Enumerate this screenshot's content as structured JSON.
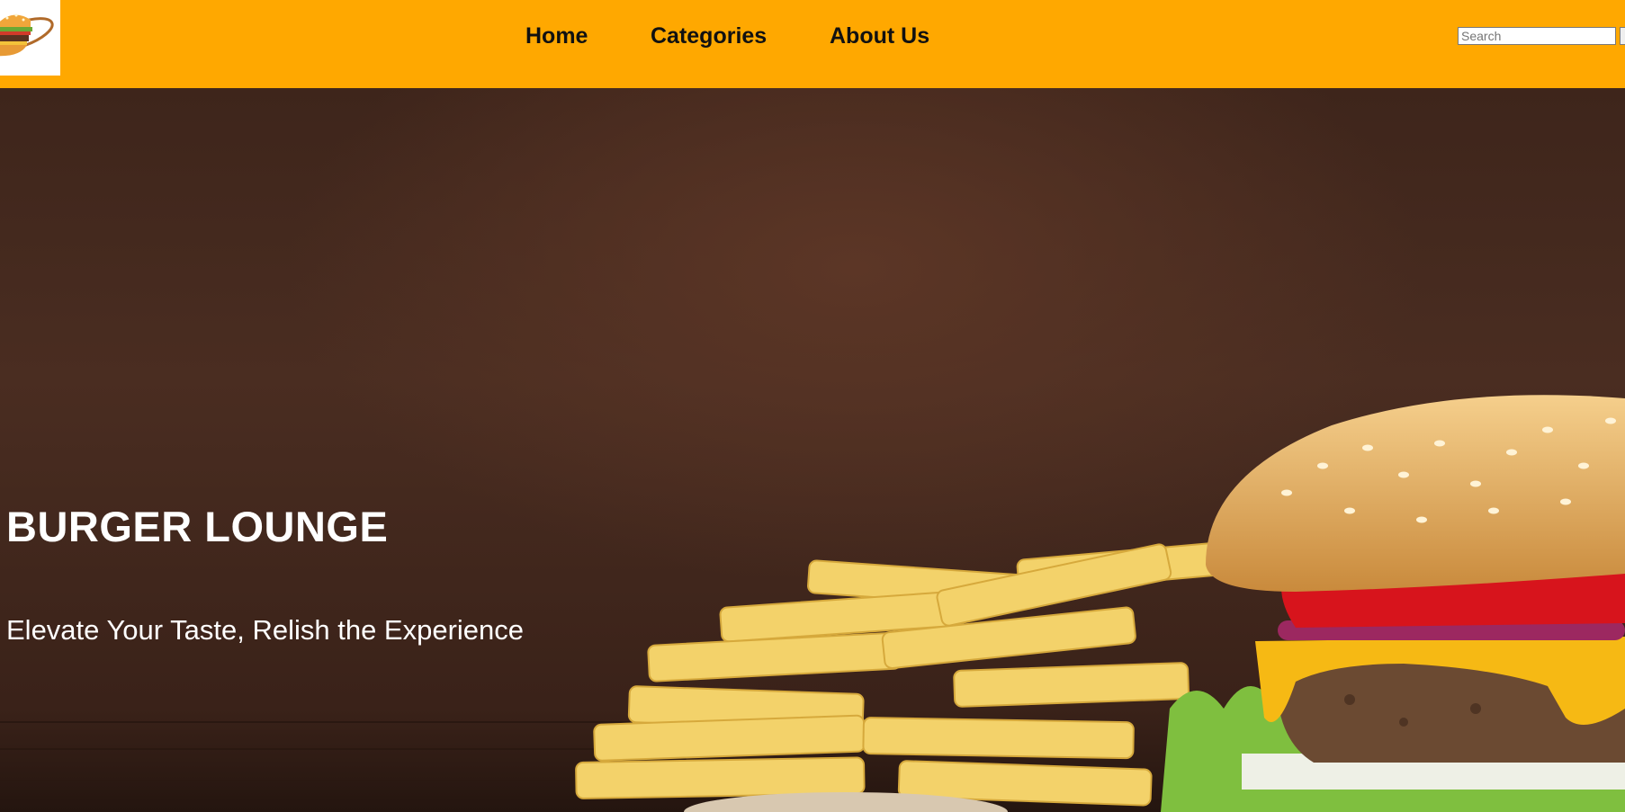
{
  "nav": {
    "logo_icon": "burger-logo-icon",
    "links": [
      {
        "label": "Home"
      },
      {
        "label": "Categories"
      },
      {
        "label": "About Us"
      }
    ],
    "search": {
      "placeholder": "Search",
      "value": ""
    }
  },
  "hero": {
    "title": "BURGER LOUNGE",
    "tagline": "Elevate Your Taste, Relish the Experience",
    "image_subject": "burger-and-fries-photo"
  },
  "colors": {
    "navbar": "#ffa800",
    "hero_background": "#4a2d21",
    "hero_text": "#ffffff"
  }
}
